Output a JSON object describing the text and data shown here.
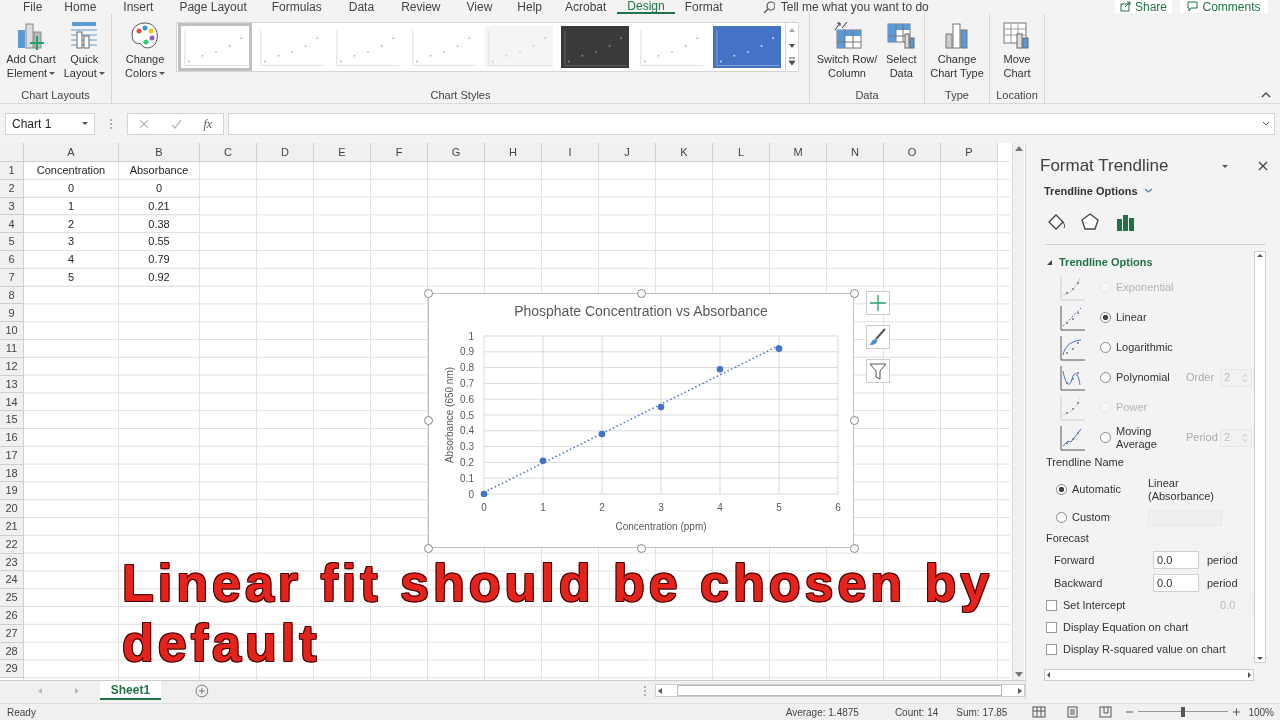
{
  "menu_tabs": [
    {
      "label": "File",
      "selected": false
    },
    {
      "label": "Home",
      "selected": false
    },
    {
      "label": "Insert",
      "selected": false
    },
    {
      "label": "Page Layout",
      "selected": false
    },
    {
      "label": "Formulas",
      "selected": false
    },
    {
      "label": "Data",
      "selected": false
    },
    {
      "label": "Review",
      "selected": false
    },
    {
      "label": "View",
      "selected": false
    },
    {
      "label": "Help",
      "selected": false
    },
    {
      "label": "Acrobat",
      "selected": false
    },
    {
      "label": "Design",
      "selected": true
    },
    {
      "label": "Format",
      "selected": false
    }
  ],
  "tell_me": {
    "placeholder": "Tell me what you want to do"
  },
  "share_button": "Share",
  "comments_button": "Comments",
  "ribbon_groups": [
    {
      "label": "Chart Layouts",
      "buttons": [
        {
          "lines": [
            "Add Chart",
            "Element"
          ],
          "dropdown": true
        },
        {
          "lines": [
            "Quick",
            "Layout"
          ],
          "dropdown": true
        }
      ]
    },
    {
      "label": "Chart Styles",
      "buttons": [
        {
          "lines": [
            "Change",
            "Colors"
          ],
          "dropdown": true
        }
      ],
      "styles": [
        {
          "kind": "white",
          "selected": true
        },
        {
          "kind": "white",
          "selected": false
        },
        {
          "kind": "white",
          "selected": false
        },
        {
          "kind": "white",
          "selected": false
        },
        {
          "kind": "grey",
          "selected": false
        },
        {
          "kind": "dark",
          "selected": false
        },
        {
          "kind": "white",
          "selected": false
        },
        {
          "kind": "blue",
          "selected": false
        }
      ]
    },
    {
      "label": "Data",
      "buttons": [
        {
          "lines": [
            "Switch Row/",
            "Column"
          ],
          "dropdown": false
        },
        {
          "lines": [
            "Select",
            "Data"
          ],
          "dropdown": false
        }
      ]
    },
    {
      "label": "Type",
      "buttons": [
        {
          "lines": [
            "Change",
            "Chart Type"
          ],
          "dropdown": false
        }
      ]
    },
    {
      "label": "Location",
      "buttons": [
        {
          "lines": [
            "Move",
            "Chart"
          ],
          "dropdown": false
        }
      ]
    }
  ],
  "formula_bar": {
    "name_box": "Chart 1",
    "function_label": "fx"
  },
  "sheet": {
    "columns": [
      "A",
      "B",
      "C",
      "D",
      "E",
      "F",
      "G",
      "H",
      "I",
      "J",
      "K",
      "L",
      "M",
      "N",
      "O",
      "P"
    ],
    "rows": [
      {
        "header": "1",
        "cells": [
          "Concentration",
          "Absorbance"
        ]
      },
      {
        "header": "2",
        "cells": [
          "0",
          "0"
        ]
      },
      {
        "header": "3",
        "cells": [
          "1",
          "0.21"
        ]
      },
      {
        "header": "4",
        "cells": [
          "2",
          "0.38"
        ]
      },
      {
        "header": "5",
        "cells": [
          "3",
          "0.55"
        ]
      },
      {
        "header": "6",
        "cells": [
          "4",
          "0.79"
        ]
      },
      {
        "header": "7",
        "cells": [
          "5",
          "0.92"
        ]
      },
      {
        "header": "8"
      },
      {
        "header": "9"
      },
      {
        "header": "10"
      },
      {
        "header": "11"
      },
      {
        "header": "12"
      },
      {
        "header": "13"
      },
      {
        "header": "14"
      },
      {
        "header": "15"
      },
      {
        "header": "16"
      },
      {
        "header": "17"
      },
      {
        "header": "18"
      },
      {
        "header": "19"
      },
      {
        "header": "20"
      },
      {
        "header": "21"
      },
      {
        "header": "22"
      },
      {
        "header": "23"
      },
      {
        "header": "24"
      },
      {
        "header": "25"
      },
      {
        "header": "26"
      },
      {
        "header": "27"
      },
      {
        "header": "28"
      },
      {
        "header": "29"
      }
    ]
  },
  "chart": {
    "chart_data": {
      "type": "scatter",
      "title": "Phosphate Concentration vs Absorbance",
      "xlabel": "Concentration (ppm)",
      "ylabel": "Absorbance (650 nm)",
      "x": [
        0,
        1,
        2,
        3,
        4,
        5
      ],
      "series": [
        {
          "type": "scatter",
          "color": "#4472c4",
          "values": [
            0,
            0.21,
            0.38,
            0.55,
            0.79,
            0.92
          ]
        },
        {
          "type": "line",
          "color": "#4472c4",
          "line_style": "dotted",
          "values": [
            0.01,
            0.196,
            0.382,
            0.568,
            0.754,
            0.94
          ]
        }
      ],
      "grid": true,
      "xlim": [
        0,
        6
      ],
      "ylim": [
        0,
        1
      ],
      "xticks": [
        0,
        1,
        2,
        3,
        4,
        5,
        6
      ],
      "yticks": [
        0,
        0.1,
        0.2,
        0.3,
        0.4,
        0.5,
        0.6,
        0.7,
        0.8,
        0.9,
        1
      ]
    }
  },
  "caption": "Linear fit should be chosen by default",
  "format_pane": {
    "title": "Format Trendline",
    "options_menu": "Trendline Options",
    "section": {
      "label": "Trendline Options",
      "expanded": true
    },
    "types": [
      {
        "label": "Exponential",
        "selected": false,
        "disabled": true
      },
      {
        "label": "Linear",
        "selected": true,
        "disabled": false
      },
      {
        "label": "Logarithmic",
        "selected": false,
        "disabled": false
      },
      {
        "label": "Polynomial",
        "selected": false,
        "disabled": false,
        "setting": {
          "label": "Order",
          "value": "2"
        }
      },
      {
        "label": "Power",
        "selected": false,
        "disabled": true
      },
      {
        "label": "Moving Average",
        "selected": false,
        "disabled": false,
        "setting": {
          "label": "Period",
          "value": "2"
        }
      }
    ],
    "name_heading": "Trendline Name",
    "name_options": [
      {
        "label": "Automatic",
        "selected": true,
        "value": "Linear (Absorbance)"
      },
      {
        "label": "Custom",
        "selected": false
      }
    ],
    "forecast_heading": "Forecast",
    "forecast": [
      {
        "label": "Forward",
        "value": "0.0",
        "unit": "period"
      },
      {
        "label": "Backward",
        "value": "0.0",
        "unit": "period"
      }
    ],
    "options": [
      {
        "label": "Set Intercept",
        "checked": false,
        "value": "0.0"
      },
      {
        "label": "Display Equation on chart",
        "checked": false
      },
      {
        "label": "Display R-squared value on chart",
        "checked": false
      }
    ]
  },
  "sheet_tabs": [
    {
      "label": "Sheet1",
      "selected": true
    }
  ],
  "status_bar": {
    "mode": "Ready",
    "average": "Average: 1.4875",
    "count": "Count: 14",
    "sum": "Sum: 17.85",
    "zoom": {
      "level": 0.5,
      "reading": "100%"
    }
  }
}
